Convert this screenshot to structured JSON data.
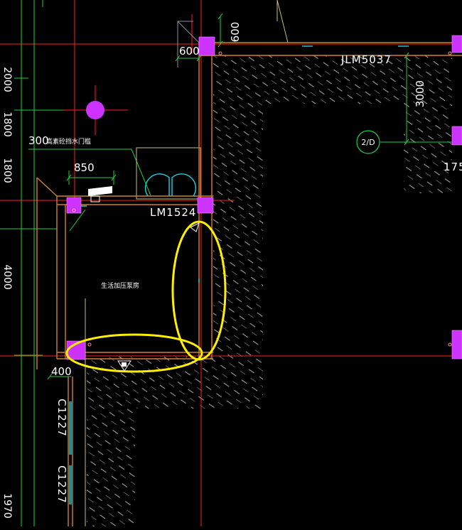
{
  "drawing": {
    "background": "#000000",
    "colors": {
      "wall": "#d08030",
      "grid_red": "#ff2020",
      "grid_green": "#20d040",
      "dim_green": "#20c060",
      "cyan": "#22d0e0",
      "column": "#cc33ff",
      "hatch": "#a0a0a0",
      "highlight": "#ffee00",
      "text": "#ffffff"
    },
    "dimensions": {
      "d600_top": "600",
      "d600_left": "600",
      "d850": "850",
      "d3000": "3000",
      "d400": "400"
    },
    "labels": {
      "window_top": "JLM5037",
      "door_mid": "LM1524",
      "window_left_1": "C1227",
      "window_left_2": "C1227",
      "note_300": "300",
      "note_300_suffix": "高素砼挡水门槛",
      "room_name": "生活加压泵房",
      "axis_tag": "2/D",
      "right_edge": "175"
    },
    "left_edge_marks": [
      "2000",
      "1800",
      "1800",
      "4000",
      "1970"
    ],
    "highlights": [
      {
        "shape": "ellipse",
        "name": "vertical-wall-highlight"
      },
      {
        "shape": "ellipse",
        "name": "horizontal-wall-highlight"
      }
    ]
  }
}
